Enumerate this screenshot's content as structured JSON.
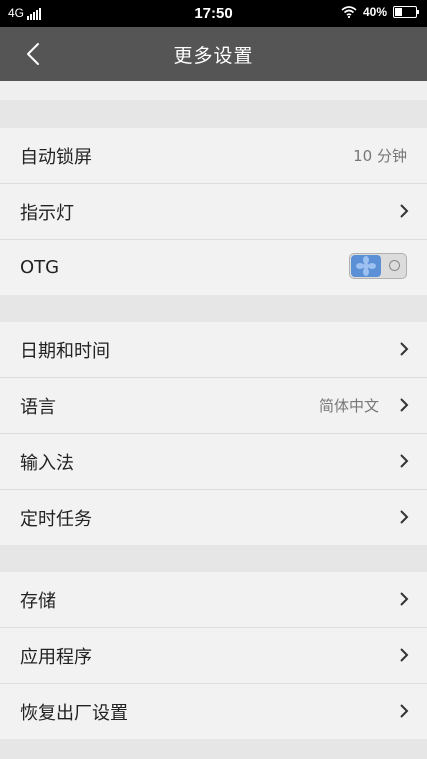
{
  "status_bar": {
    "network": "4G",
    "time": "17:50",
    "battery_percent": "40%",
    "battery_level": 0.4
  },
  "header": {
    "title": "更多设置",
    "back_icon": "back-chevron-icon"
  },
  "groups": [
    {
      "rows": [
        {
          "label": "自动锁屏",
          "value": "10 分钟",
          "chevron": false
        },
        {
          "label": "指示灯",
          "value": "",
          "chevron": true
        },
        {
          "label": "OTG",
          "value": "",
          "chevron": false,
          "toggle": true,
          "toggle_on": false
        }
      ]
    },
    {
      "rows": [
        {
          "label": "日期和时间",
          "value": "",
          "chevron": true
        },
        {
          "label": "语言",
          "value": "简体中文",
          "chevron": true
        },
        {
          "label": "输入法",
          "value": "",
          "chevron": true
        },
        {
          "label": "定时任务",
          "value": "",
          "chevron": true
        }
      ]
    },
    {
      "rows": [
        {
          "label": "存储",
          "value": "",
          "chevron": true
        },
        {
          "label": "应用程序",
          "value": "",
          "chevron": true
        },
        {
          "label": "恢复出厂设置",
          "value": "",
          "chevron": true
        }
      ]
    }
  ],
  "colors": {
    "header_bg": "#555555",
    "row_bg": "#f2f2f2",
    "page_bg": "#e6e6e6",
    "toggle_accent": "#5b8fd6"
  }
}
